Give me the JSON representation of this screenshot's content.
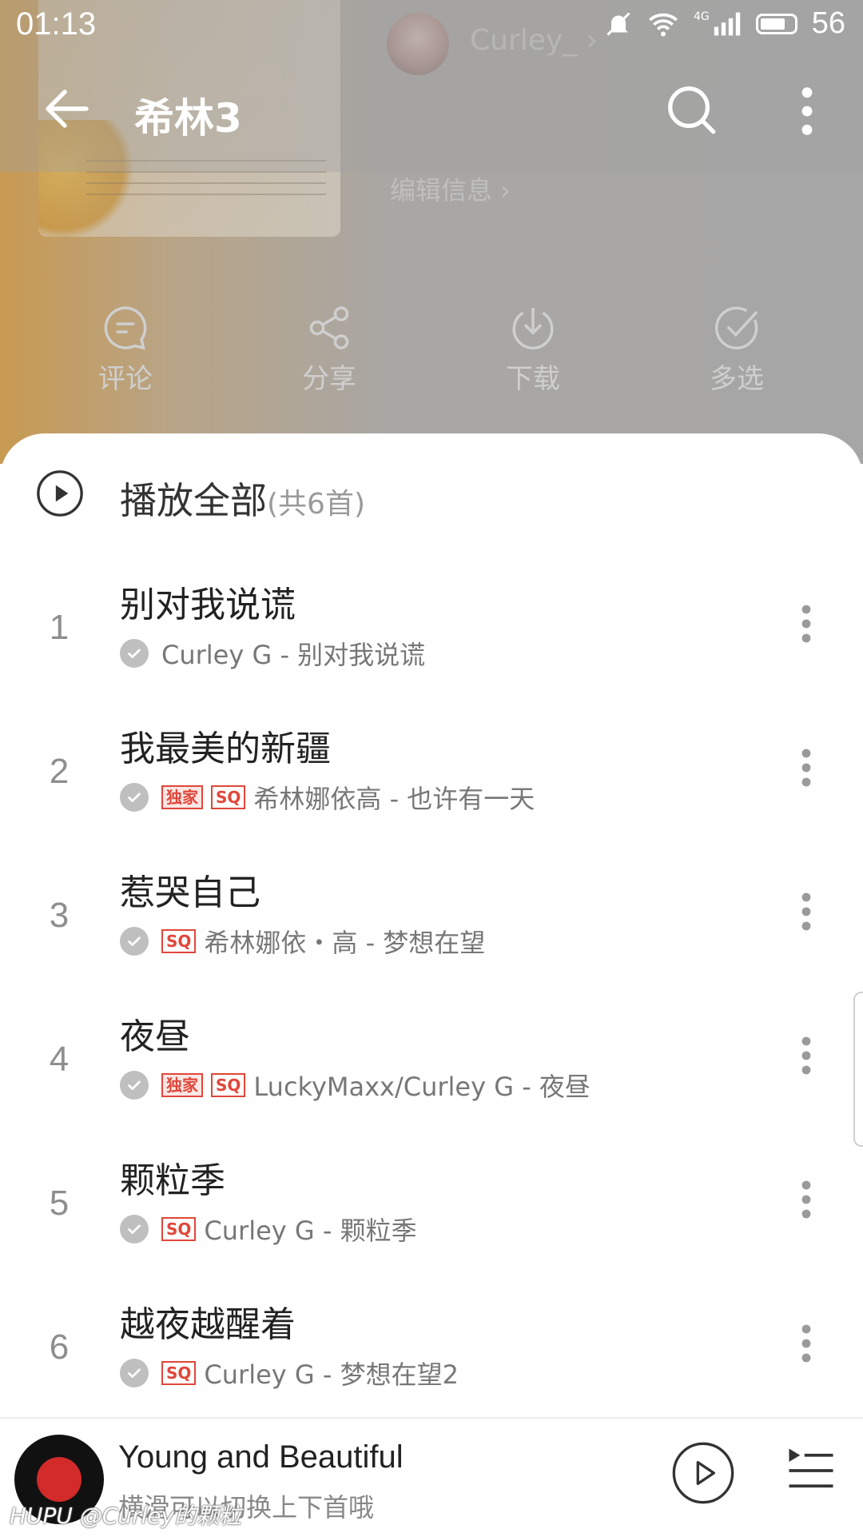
{
  "status": {
    "time": "01:13",
    "network": "4G",
    "battery": "56"
  },
  "header": {
    "title": "希林3",
    "creator": "Curley_",
    "edit_info": "编辑信息"
  },
  "actions": [
    {
      "label": "评论",
      "icon": "comment-icon"
    },
    {
      "label": "分享",
      "icon": "share-icon"
    },
    {
      "label": "下载",
      "icon": "download-icon"
    },
    {
      "label": "多选",
      "icon": "multiselect-icon"
    }
  ],
  "play_all": {
    "label": "播放全部",
    "count": "(共6首)"
  },
  "songs": [
    {
      "num": "1",
      "title": "别对我说谎",
      "tags": [],
      "meta": "Curley G - 别对我说谎"
    },
    {
      "num": "2",
      "title": "我最美的新疆",
      "tags": [
        "独家",
        "SQ"
      ],
      "meta": "希林娜依高 - 也许有一天"
    },
    {
      "num": "3",
      "title": "惹哭自己",
      "tags": [
        "SQ"
      ],
      "meta": "希林娜依・高 - 梦想在望"
    },
    {
      "num": "4",
      "title": "夜昼",
      "tags": [
        "独家",
        "SQ"
      ],
      "meta": "LuckyMaxx/Curley G - 夜昼"
    },
    {
      "num": "5",
      "title": "颗粒季",
      "tags": [
        "SQ"
      ],
      "meta": "Curley G - 颗粒季"
    },
    {
      "num": "6",
      "title": "越夜越醒着",
      "tags": [
        "SQ"
      ],
      "meta": "Curley G - 梦想在望2"
    }
  ],
  "player": {
    "title": "Young and Beautiful",
    "subtitle": "横滑可以切换上下首哦",
    "watermark": "HUPU @Curley的颗粒"
  },
  "colors": {
    "tag": "#e0473a",
    "check": "#bfbfbf",
    "disc": "#d32a2a"
  }
}
